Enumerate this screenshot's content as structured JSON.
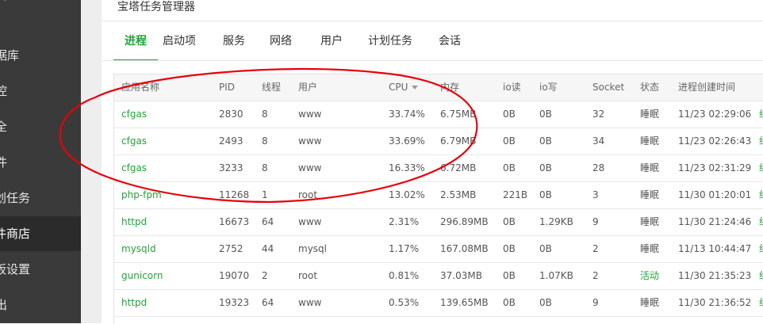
{
  "sidebar": {
    "items": [
      {
        "label": "库"
      },
      {
        "label": "据库"
      },
      {
        "label": "控"
      },
      {
        "label": "全"
      },
      {
        "label": "件"
      },
      {
        "label": "划任务"
      },
      {
        "label": "件商店"
      },
      {
        "label": "板设置"
      },
      {
        "label": "出"
      }
    ],
    "active_index": 6
  },
  "panel": {
    "title": "宝塔任务管理器"
  },
  "tabs": [
    {
      "label": "进程",
      "active": true
    },
    {
      "label": "启动项"
    },
    {
      "label": "服务"
    },
    {
      "label": "网络"
    },
    {
      "label": "用户"
    },
    {
      "label": "计划任务"
    },
    {
      "label": "会话"
    }
  ],
  "table": {
    "headers": [
      "应用名称",
      "PID",
      "线程",
      "用户",
      "CPU",
      "内存",
      "io读",
      "io写",
      "Socket",
      "状态",
      "进程创建时间"
    ],
    "rows": [
      {
        "cells": [
          "cfgas",
          "2830",
          "8",
          "www",
          "33.74%",
          "6.75MB",
          "0B",
          "0B",
          "32",
          "睡眠",
          "11/23 02:29:06"
        ],
        "edge": "约"
      },
      {
        "cells": [
          "cfgas",
          "2493",
          "8",
          "www",
          "33.69%",
          "6.79MB",
          "0B",
          "0B",
          "34",
          "睡眠",
          "11/23 02:26:43"
        ],
        "edge": "约"
      },
      {
        "cells": [
          "cfgas",
          "3233",
          "8",
          "www",
          "16.33%",
          "6.72MB",
          "0B",
          "0B",
          "28",
          "睡眠",
          "11/23 02:31:29"
        ],
        "edge": "约"
      },
      {
        "cells": [
          "php-fpm",
          "11268",
          "1",
          "root",
          "13.02%",
          "2.53MB",
          "221B",
          "0B",
          "3",
          "睡眠",
          "11/30 01:20:01"
        ],
        "edge": "约"
      },
      {
        "cells": [
          "httpd",
          "16673",
          "64",
          "www",
          "2.31%",
          "296.89MB",
          "0B",
          "1.29KB",
          "9",
          "睡眠",
          "11/30 21:24:46"
        ],
        "edge": "约"
      },
      {
        "cells": [
          "mysqld",
          "2752",
          "44",
          "mysql",
          "1.17%",
          "167.08MB",
          "0B",
          "0B",
          "2",
          "睡眠",
          "11/13 10:44:47"
        ],
        "edge": "约"
      },
      {
        "cells": [
          "gunicorn",
          "19070",
          "2",
          "root",
          "0.81%",
          "37.03MB",
          "0B",
          "1.07KB",
          "2",
          "活动",
          "11/30 21:35:23"
        ],
        "edge": "约"
      },
      {
        "cells": [
          "httpd",
          "19323",
          "64",
          "www",
          "0.53%",
          "139.65MB",
          "0B",
          "0B",
          "9",
          "睡眠",
          "11/30 21:36:52"
        ],
        "edge": "约"
      }
    ]
  },
  "colors": {
    "accent": "#20a53a",
    "annotation": "#e8000b",
    "sidebar": "#3a3a3a"
  }
}
